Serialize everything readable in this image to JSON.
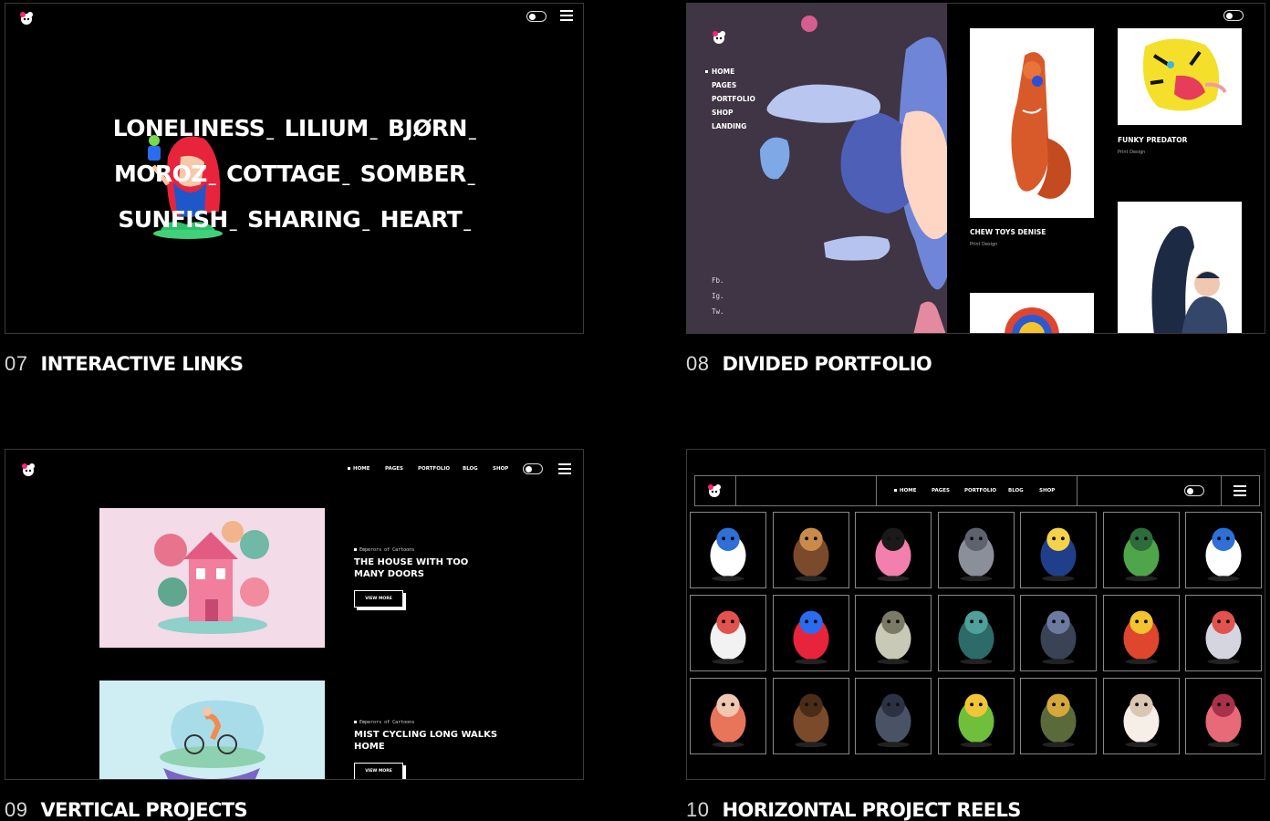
{
  "items": [
    {
      "num": "07",
      "title": "INTERACTIVE LINKS"
    },
    {
      "num": "08",
      "title": "DIVIDED PORTFOLIO"
    },
    {
      "num": "09",
      "title": "VERTICAL PROJECTS"
    },
    {
      "num": "10",
      "title": "HORIZONTAL PROJECT REELS"
    }
  ],
  "interactive_links": {
    "rows": [
      [
        "LONELINESS",
        "LILIUM",
        "BJØRN"
      ],
      [
        "MOROZ",
        "COTTAGE",
        "SOMBER"
      ],
      [
        "SUNFISH",
        "SHARING",
        "HEART"
      ]
    ]
  },
  "divided_portfolio": {
    "nav": [
      "HOME",
      "PAGES",
      "PORTFOLIO",
      "SHOP",
      "LANDING"
    ],
    "social": [
      "Fb.",
      "Ig.",
      "Tw."
    ],
    "projects": [
      {
        "title": "CHEW TOYS DENISE",
        "category": "Print Design"
      },
      {
        "title": "FUNKY PREDATOR",
        "category": "Print Design"
      }
    ]
  },
  "vertical_projects": {
    "nav": [
      "HOME",
      "PAGES",
      "PORTFOLIO",
      "BLOG",
      "SHOP"
    ],
    "projects": [
      {
        "eyebrow": "Emperors of Cartoons",
        "title_l1": "THE HOUSE WITH TOO",
        "title_l2": "MANY DOORS",
        "button": "VIEW MORE"
      },
      {
        "eyebrow": "Emperors of Cartoons",
        "title_l1": "MIST CYCLING LONG WALKS",
        "title_l2": "HOME",
        "button": "VIEW MORE"
      }
    ]
  },
  "horizontal_reels": {
    "nav": [
      "HOME",
      "PAGES",
      "PORTFOLIO",
      "BLOG",
      "SHOP"
    ],
    "tiles": [
      "astronaut-cat",
      "caveman-with-club",
      "pink-flower-face",
      "grey-cat",
      "night-island-house",
      "green-crocodile",
      "astronaut-cat",
      "gameboy-character",
      "red-bearded-gnome",
      "knight-with-shield",
      "sea-creature",
      "haunted-house",
      "red-demon-mask",
      "skull-with-arrow",
      "red-hair-girl",
      "brown-bear",
      "octopus-figure",
      "green-frog",
      "armored-warrior",
      "white-cat",
      "anatomical-heart"
    ]
  },
  "colors": {
    "background": "#000000",
    "border": "#3a3a3a",
    "portfolio_left_bg": "#3f3545",
    "house_card_bg": "#f4dbe8",
    "bike_card_bg": "#cfeef4"
  }
}
